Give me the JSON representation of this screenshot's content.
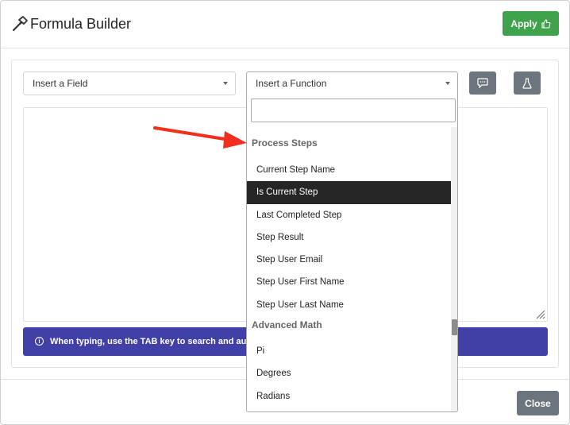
{
  "header": {
    "title": "Formula Builder",
    "apply_label": "Apply",
    "title_icon": "hammer-icon",
    "apply_icon": "thumbs-up-icon"
  },
  "toolbar": {
    "field_select": "Insert a Field",
    "function_select": "Insert a Function",
    "comment_icon": "comment-icon",
    "test_icon": "flask-icon"
  },
  "info_bar": {
    "text": "When typing, use the TAB key to search and autoco",
    "icon": "info-icon"
  },
  "footer": {
    "close_label": "Close"
  },
  "dropdown": {
    "search_value": "",
    "groups": [
      {
        "label": "Process Steps",
        "items": [
          {
            "label": "Current Step Name"
          },
          {
            "label": "Is Current Step",
            "highlighted": true
          },
          {
            "label": "Last Completed Step"
          },
          {
            "label": "Step Result"
          },
          {
            "label": "Step User Email"
          },
          {
            "label": "Step User First Name"
          },
          {
            "label": "Step User Last Name"
          }
        ]
      },
      {
        "label": "Advanced Math",
        "items": [
          {
            "label": "Pi"
          },
          {
            "label": "Degrees"
          },
          {
            "label": "Radians"
          }
        ]
      }
    ]
  },
  "colors": {
    "apply": "#3ea34a",
    "secondary": "#6c757d",
    "info": "#4040a6",
    "highlight": "#262626",
    "annotation_arrow": "#f0301c"
  }
}
